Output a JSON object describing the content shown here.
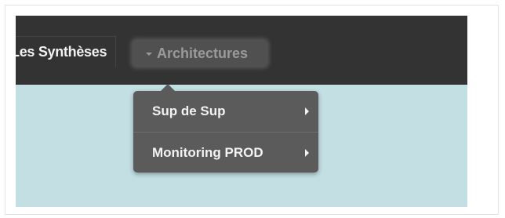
{
  "nav": {
    "tabs": [
      {
        "label": "Les Synthèses"
      },
      {
        "label": "Architectures",
        "icon": "caret-down-icon"
      }
    ]
  },
  "dropdown": {
    "items": [
      {
        "label": "Sup de Sup",
        "icon": "chevron-right-icon"
      },
      {
        "label": "Monitoring PROD",
        "icon": "chevron-right-icon"
      }
    ]
  },
  "colors": {
    "topbar": "#333333",
    "content_background": "#c3dfe3",
    "dropdown_background": "#5b5b5b",
    "active_tab_text": "#9a9a9a"
  }
}
